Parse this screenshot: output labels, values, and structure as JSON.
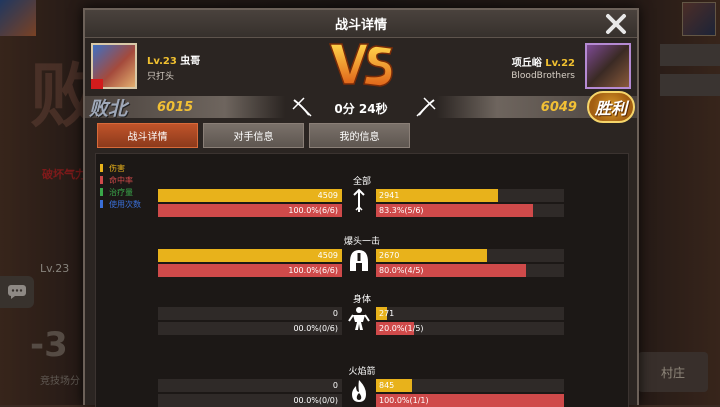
{
  "modal": {
    "title": "战斗详情"
  },
  "left_player": {
    "level": "Lv.23",
    "name": "虫哥",
    "subtitle": "只打头",
    "result": "败北",
    "score": "6015"
  },
  "right_player": {
    "level": "Lv.22",
    "name": "项丘峪",
    "subtitle": "BloodBrothers",
    "result": "胜利",
    "score": "6049"
  },
  "duration": "0分 24秒",
  "tabs": [
    {
      "label": "战斗详情",
      "active": true
    },
    {
      "label": "对手信息",
      "active": false
    },
    {
      "label": "我的信息",
      "active": false
    }
  ],
  "legend": [
    {
      "label": "伤害",
      "color": "#e8b21b"
    },
    {
      "label": "命中率",
      "color": "#cf4a4a"
    },
    {
      "label": "治疗量",
      "color": "#3aa84a"
    },
    {
      "label": "使用次数",
      "color": "#3a6fd8"
    }
  ],
  "stats": [
    {
      "title": "全部",
      "icon": "arrow-icon",
      "left_damage": "4509",
      "left_damage_pct": 1.0,
      "right_damage": "2941",
      "right_damage_pct": 0.65,
      "left_hit": "100.0%(6/6)",
      "left_hit_pct": 1.0,
      "right_hit": "83.3%(5/6)",
      "right_hit_pct": 0.833
    },
    {
      "title": "爆头一击",
      "icon": "helmet-icon",
      "left_damage": "4509",
      "left_damage_pct": 1.0,
      "right_damage": "2670",
      "right_damage_pct": 0.59,
      "left_hit": "100.0%(6/6)",
      "left_hit_pct": 1.0,
      "right_hit": "80.0%(4/5)",
      "right_hit_pct": 0.8
    },
    {
      "title": "身体",
      "icon": "body-icon",
      "left_damage": "0",
      "left_damage_pct": 0.0,
      "right_damage": "271",
      "right_damage_pct": 0.06,
      "left_hit": "00.0%(0/6)",
      "left_hit_pct": 0.0,
      "right_hit": "20.0%(1/5)",
      "right_hit_pct": 0.2
    },
    {
      "title": "火焰箭",
      "icon": "fire-icon",
      "left_damage": "0",
      "left_damage_pct": 0.0,
      "right_damage": "845",
      "right_damage_pct": 0.19,
      "left_hit": "00.0%(0/0)",
      "left_hit_pct": 0.0,
      "right_hit": "100.0%(1/1)",
      "right_hit_pct": 1.0
    }
  ],
  "background": {
    "left_label": "破坏气力",
    "left_level": "Lv.23",
    "left_value": "-3",
    "left_bottom_text": "竞技场分",
    "right_button": "村庄"
  }
}
